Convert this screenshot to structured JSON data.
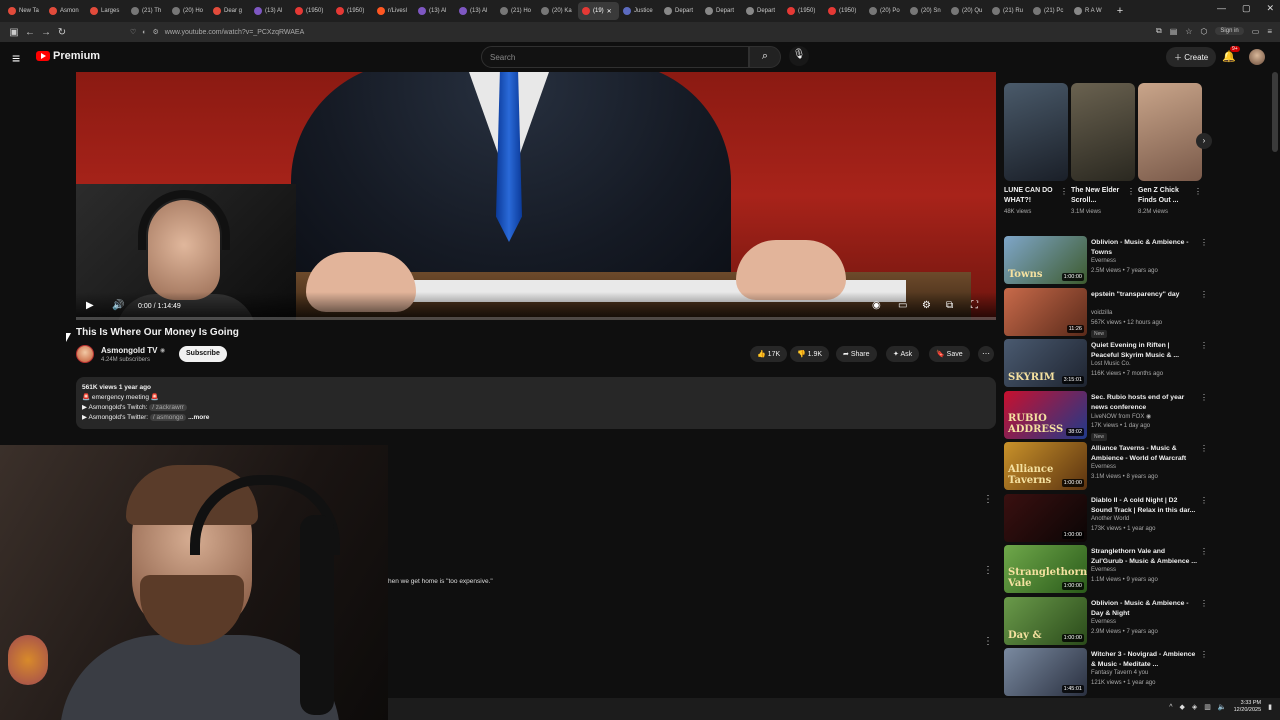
{
  "browser": {
    "tabs": [
      {
        "label": "New Ta",
        "color": "#e24b3b"
      },
      {
        "label": "Asmon",
        "color": "#e24b3b"
      },
      {
        "label": "Larges",
        "color": "#e24b3b"
      },
      {
        "label": "(21) Th",
        "color": "#777"
      },
      {
        "label": "(20) Ho",
        "color": "#777"
      },
      {
        "label": "Dear g",
        "color": "#e24b3b"
      },
      {
        "label": "(13) Al",
        "color": "#7e57c2"
      },
      {
        "label": "(1950)",
        "color": "#e53935"
      },
      {
        "label": "(1950)",
        "color": "#e53935"
      },
      {
        "label": "r/Livesl",
        "color": "#ff5722"
      },
      {
        "label": "(13) Al",
        "color": "#7e57c2"
      },
      {
        "label": "(13) Al",
        "color": "#7e57c2"
      },
      {
        "label": "(21) Ho",
        "color": "#777"
      },
      {
        "label": "(20) Ka",
        "color": "#777"
      },
      {
        "label": "(19)",
        "color": "#e53935",
        "active": true
      },
      {
        "label": "Justice",
        "color": "#5c6bc0"
      },
      {
        "label": "Depart",
        "color": "#888"
      },
      {
        "label": "Depart",
        "color": "#888"
      },
      {
        "label": "Depart",
        "color": "#888"
      },
      {
        "label": "(1950)",
        "color": "#e53935"
      },
      {
        "label": "(1950)",
        "color": "#e53935"
      },
      {
        "label": "(20) Po",
        "color": "#777"
      },
      {
        "label": "(20) Sn",
        "color": "#777"
      },
      {
        "label": "(20) Qu",
        "color": "#777"
      },
      {
        "label": "(21) Ru",
        "color": "#777"
      },
      {
        "label": "(21) Pc",
        "color": "#777"
      },
      {
        "label": "R A W",
        "color": "#888"
      }
    ],
    "new_tab": "+",
    "url": "www.youtube.com/watch?v=_PCXzqRWAEA",
    "sign_in": "Sign in"
  },
  "header": {
    "logo": "Premium",
    "search_placeholder": "Search",
    "create": "Create",
    "notif_count": "9+"
  },
  "player": {
    "time_current": "0:00",
    "time_total": "1:14:49",
    "progress": 0.0
  },
  "video": {
    "title": "This Is Where Our Money Is Going",
    "channel": "Asmongold TV",
    "verified": "◉",
    "subscribers": "4.24M subscribers",
    "subscribe": "Subscribe",
    "likes": "17K",
    "dislikes": "1.9K",
    "share": "Share",
    "ask": "Ask",
    "save": "Save"
  },
  "description": {
    "meta": "561K views  1 year ago",
    "line1": "🚨 emergency meeting 🚨",
    "line2_prefix": "▶ Asmongold's Twitch: ",
    "line2_chip": "/ zackrawrr",
    "line3_prefix": "▶ Asmongold's Twitter: ",
    "line3_chip": "/ asmongo",
    "more": "...more"
  },
  "comments": {
    "visible_text": "hen we get home is \"too expensive.\""
  },
  "shorts": [
    {
      "title": "LUNE CAN DO WHAT?!",
      "views": "48K views",
      "thumb_a": "#4a5a6a",
      "thumb_b": "#1a1f28"
    },
    {
      "title": "The New Elder Scroll...",
      "views": "3.1M views",
      "thumb_a": "#6a6250",
      "thumb_b": "#2a2820"
    },
    {
      "title": "Gen Z Chick Finds Out ...",
      "views": "8.2M views",
      "thumb_a": "#c9a58a",
      "thumb_b": "#7a5a4a"
    }
  ],
  "recommendations": [
    {
      "title": "Oblivion - Music & Ambience - Towns",
      "channel": "Everness",
      "stats": "2.5M views • 7 years ago",
      "duration": "1:00:00",
      "thumb_text": "Towns",
      "new": "",
      "thumb_a": "#7fa6c9",
      "thumb_b": "#3d5b2e"
    },
    {
      "title": "epstein \"transparency\" day",
      "channel": "voidzilla",
      "stats": "567K views • 12 hours ago",
      "duration": "11:26",
      "thumb_text": "",
      "new": "New",
      "thumb_a": "#c86a4a",
      "thumb_b": "#5a2a1a"
    },
    {
      "title": "Quiet Evening in Riften | Peaceful Skyrim Music & ...",
      "channel": "Lost Music Co.",
      "stats": "116K views • 7 months ago",
      "duration": "3:15:01",
      "thumb_text": "SKYRIM",
      "new": "",
      "thumb_a": "#4a5a70",
      "thumb_b": "#1e2430"
    },
    {
      "title": "Sec. Rubio hosts end of year news conference",
      "channel": "LiveNOW from FOX ◉",
      "stats": "17K views • 1 day ago",
      "duration": "38:02",
      "thumb_text": "RUBIO ADDRESS",
      "new": "New",
      "thumb_a": "#c8102e",
      "thumb_b": "#1f3a8a"
    },
    {
      "title": "Alliance Taverns - Music & Ambience - World of Warcraft",
      "channel": "Everness",
      "stats": "3.1M views • 8 years ago",
      "duration": "1:00:00",
      "thumb_text": "Alliance Taverns",
      "new": "",
      "thumb_a": "#c9922a",
      "thumb_b": "#5a3210"
    },
    {
      "title": "Diablo II - A cold Night | D2 Sound Track | Relax in this dar...",
      "channel": "Another World",
      "stats": "173K views • 1 year ago",
      "duration": "1:00:00",
      "thumb_text": "",
      "new": "",
      "thumb_a": "#3a1010",
      "thumb_b": "#0a0505"
    },
    {
      "title": "Stranglethorn Vale and Zul'Gurub - Music & Ambience ...",
      "channel": "Everness",
      "stats": "1.1M views • 9 years ago",
      "duration": "1:00:00",
      "thumb_text": "Stranglethorn Vale",
      "new": "",
      "thumb_a": "#6fa84a",
      "thumb_b": "#2a5a1a"
    },
    {
      "title": "Oblivion - Music & Ambience - Day & Night",
      "channel": "Everness",
      "stats": "2.9M views • 7 years ago",
      "duration": "1:00:00",
      "thumb_text": "Day &",
      "new": "",
      "thumb_a": "#6a9a4a",
      "thumb_b": "#2a4a1a"
    },
    {
      "title": "Witcher 3 - Novigrad - Ambience & Music - Meditate ...",
      "channel": "Fantasy Tavern 4 you",
      "stats": "121K views • 1 year ago",
      "duration": "1:45:01",
      "thumb_text": "",
      "new": "",
      "thumb_a": "#7a8aa0",
      "thumb_b": "#2a3040"
    }
  ],
  "taskbar": {
    "time": "3:33 PM",
    "date": "12/20/2025"
  }
}
